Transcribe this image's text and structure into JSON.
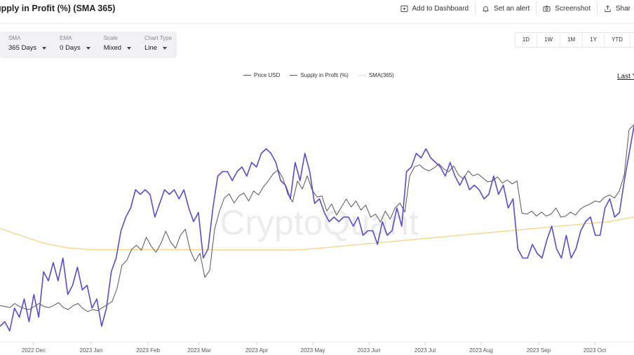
{
  "header": {
    "title": "upply in Profit (%) (SMA 365)",
    "actions": [
      {
        "label": "Add to Dashboard",
        "icon": "dashboard-add-icon"
      },
      {
        "label": "Set an alert",
        "icon": "bell-icon"
      },
      {
        "label": "Screenshot",
        "icon": "camera-icon"
      },
      {
        "label": "Shar",
        "icon": "share-icon"
      }
    ]
  },
  "controls": [
    {
      "label": "SMA",
      "value": "365 Days"
    },
    {
      "label": "EMA",
      "value": "0 Days"
    },
    {
      "label": "Scale",
      "value": "Mixed"
    },
    {
      "label": "Chart Type",
      "value": "Line"
    }
  ],
  "ranges": [
    "1D",
    "1W",
    "1M",
    "1Y",
    "YTD"
  ],
  "last_link": "Last Y",
  "watermark": "CryptoQuant",
  "colors": {
    "price": "#555555",
    "supply": "#5a4ad1",
    "sma": "#f5d68a"
  },
  "chart_data": {
    "type": "line",
    "x_ticks": [
      "2022 Dec",
      "2023 Jan",
      "2023 Feb",
      "2023 Mar",
      "2023 Apr",
      "2023 May",
      "2023 Jun",
      "2023 Jul",
      "2023 Aug",
      "2023 Sep",
      "2023 Oct"
    ],
    "series": [
      {
        "name": "Price USD",
        "values": [
          17.0,
          16.9,
          16.8,
          17.2,
          16.9,
          16.7,
          16.6,
          16.9,
          17.2,
          16.9,
          16.8,
          17.0,
          17.3,
          16.8,
          16.6,
          17.0,
          17.2,
          16.7,
          16.4,
          16.6,
          16.5,
          16.8,
          17.1,
          17.4,
          18.7,
          21.0,
          21.5,
          22.6,
          23.0,
          22.5,
          23.8,
          22.9,
          22.3,
          23.2,
          24.4,
          23.3,
          22.7,
          24.0,
          24.6,
          22.5,
          21.4,
          22.2,
          19.8,
          20.5,
          24.6,
          26.4,
          27.7,
          28.1,
          27.2,
          27.9,
          28.2,
          27.4,
          28.4,
          28.0,
          28.8,
          29.4,
          30.1,
          30.5,
          29.7,
          28.1,
          27.3,
          29.4,
          28.6,
          29.9,
          28.5,
          27.8,
          27.9,
          26.4,
          27.1,
          26.0,
          26.8,
          27.6,
          26.8,
          27.4,
          26.5,
          27.0,
          25.8,
          26.1,
          25.3,
          26.4,
          25.6,
          26.7,
          27.2,
          26.3,
          29.9,
          30.8,
          31.0,
          30.6,
          30.4,
          30.7,
          31.1,
          30.6,
          30.3,
          30.9,
          30.0,
          29.6,
          30.4,
          29.9,
          30.1,
          29.7,
          29.3,
          29.4,
          29.8,
          29.2,
          29.5,
          29.1,
          29.4,
          26.2,
          26.1,
          26.4,
          25.9,
          26.3,
          25.9,
          26.1,
          26.7,
          25.8,
          25.9,
          26.3,
          26.0,
          26.6,
          26.9,
          27.1,
          27.4,
          27.3,
          27.8,
          28.0,
          27.7,
          28.4,
          30.0,
          34.5,
          35.0
        ]
      },
      {
        "name": "Supply in Profit (%)",
        "values": [
          56,
          57,
          55,
          60,
          58,
          62,
          57,
          63,
          58,
          68,
          66,
          70,
          66,
          71,
          63,
          65,
          69,
          64,
          65,
          60,
          62,
          56,
          60,
          68,
          71,
          77,
          80,
          82,
          86,
          85,
          86,
          85,
          80,
          83,
          86,
          85,
          86,
          84,
          86,
          82,
          79,
          81,
          71,
          73,
          82,
          89,
          90,
          90,
          88,
          90,
          91,
          89,
          92,
          91,
          94,
          95,
          94,
          92,
          88,
          87,
          84,
          92,
          88,
          94,
          90,
          83,
          84,
          81,
          79,
          80,
          79,
          80,
          80,
          78,
          80,
          76,
          77,
          77,
          74,
          79,
          76,
          77,
          82,
          78,
          90,
          91,
          94,
          93,
          95,
          93,
          92,
          91,
          89,
          92,
          89,
          87,
          89,
          86,
          87,
          86,
          84,
          85,
          89,
          85,
          87,
          82,
          84,
          73,
          71,
          71,
          74,
          72,
          71,
          75,
          78,
          73,
          71,
          76,
          71,
          73,
          77,
          79,
          80,
          76,
          76,
          82,
          84,
          80,
          81,
          88,
          94,
          100
        ]
      },
      {
        "name": "SMA(365)",
        "values": [
          79.6,
          79.3,
          78.9,
          78.5,
          78.2,
          77.8,
          77.4,
          77.1,
          76.7,
          76.4,
          76.1,
          75.9,
          75.7,
          75.5,
          75.3,
          75.2,
          75.1,
          75.0,
          74.9,
          74.9,
          74.9,
          74.9,
          74.9,
          74.9,
          74.9,
          74.9,
          74.9,
          74.9,
          74.9,
          74.9,
          74.9,
          74.9,
          74.9,
          74.9,
          74.9,
          74.9,
          74.9,
          74.9,
          74.9,
          74.9,
          74.9,
          74.9,
          74.9,
          74.9,
          74.8,
          74.8,
          74.8,
          74.8,
          74.8,
          74.8,
          74.8,
          74.8,
          74.8,
          74.8,
          74.8,
          74.8,
          74.8,
          74.8,
          74.8,
          74.8,
          74.8,
          74.8,
          74.9,
          74.9,
          75.0,
          75.1,
          75.2,
          75.3,
          75.4,
          75.5,
          75.6,
          75.7,
          75.8,
          75.9,
          76.0,
          76.1,
          76.2,
          76.3,
          76.4,
          76.5,
          76.6,
          76.7,
          76.8,
          76.9,
          77.0,
          77.1,
          77.2,
          77.3,
          77.4,
          77.5,
          77.6,
          77.7,
          77.8,
          77.9,
          78.0,
          78.1,
          78.2,
          78.3,
          78.4,
          78.5,
          78.6,
          78.7,
          78.8,
          78.9,
          79.0,
          79.1,
          79.2,
          79.3,
          79.4,
          79.5,
          79.6,
          79.7,
          79.8,
          79.9,
          80.0,
          80.1,
          80.2,
          80.3,
          80.4,
          80.5,
          80.6,
          80.7,
          80.8,
          80.9,
          81.0,
          81.1,
          81.2,
          81.4,
          81.6,
          81.8,
          82.0,
          82.2
        ]
      }
    ],
    "grid": false,
    "legend_position": "top-center"
  }
}
